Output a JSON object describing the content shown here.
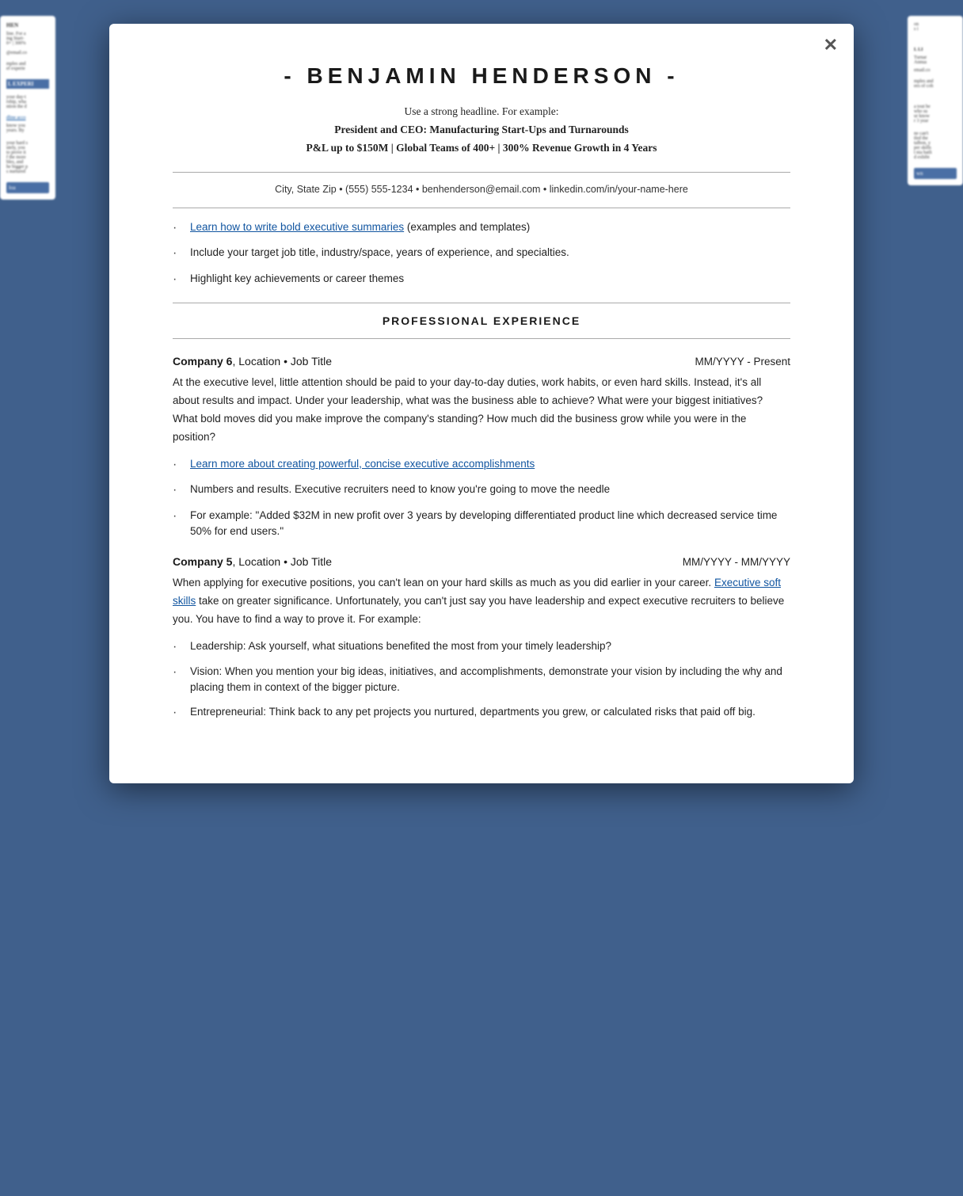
{
  "modal": {
    "close_label": "✕"
  },
  "resume": {
    "name": "- BENJAMIN HENDERSON -",
    "headline_line1": "Use a strong headline. For example:",
    "headline_line2": "President and CEO: Manufacturing Start-Ups and Turnarounds",
    "headline_line3": "P&L up to $150M | Global Teams of 400+ | 300% Revenue Growth in 4 Years",
    "contact": "City, State Zip • (555) 555-1234 • benhenderson@email.com • linkedin.com/in/your-name-here",
    "summary_bullets": [
      {
        "link_text": "Learn how to write bold executive summaries",
        "link_suffix": " (examples and templates)"
      },
      {
        "text": "Include your target job title, industry/space, years of experience, and specialties."
      },
      {
        "text": "Highlight key achievements or career themes"
      }
    ],
    "section_professional_experience": "PROFESSIONAL EXPERIENCE",
    "jobs": [
      {
        "company": "Company 6",
        "location_title": ", Location • Job Title",
        "dates": "MM/YYYY - Present",
        "description": "At the executive level, little attention should be paid to your day-to-day duties, work habits, or even hard skills. Instead, it's all about results and impact. Under your leadership, what was the business able to achieve? What were your biggest initiatives? What bold moves did you make improve the company's standing? How much did the business grow while you were in the position?",
        "bullets": [
          {
            "link_text": "Learn more about creating powerful, concise executive accomplishments",
            "link_only": true
          },
          {
            "text": "Numbers and results. Executive recruiters need to know you're going to move the needle"
          },
          {
            "text": "For example: \"Added $32M in new profit over 3 years by developing differentiated product line which decreased service time 50% for end users.\""
          }
        ]
      },
      {
        "company": "Company 5",
        "location_title": ", Location • Job Title",
        "dates": "MM/YYYY - MM/YYYY",
        "description_parts": [
          "When applying for executive positions, you can't lean on your hard skills as much as you did earlier in your career. ",
          "Executive soft skills",
          " take on greater significance. Unfortunately, you can't just say you have leadership and expect executive recruiters to believe you. You have to find a way to prove it. For example:"
        ],
        "has_link": true,
        "link_text": "Executive soft skills",
        "bullets": [
          {
            "text": "Leadership: Ask yourself, what situations benefited the most from your timely leadership?"
          },
          {
            "text": "Vision: When you mention your big ideas, initiatives, and accomplishments, demonstrate your vision by including the why and placing them in context of the bigger picture."
          },
          {
            "text": "Entrepreneurial: Think back to any pet projects you nurtured, departments you grew, or calculated risks that paid off big."
          }
        ]
      }
    ]
  }
}
